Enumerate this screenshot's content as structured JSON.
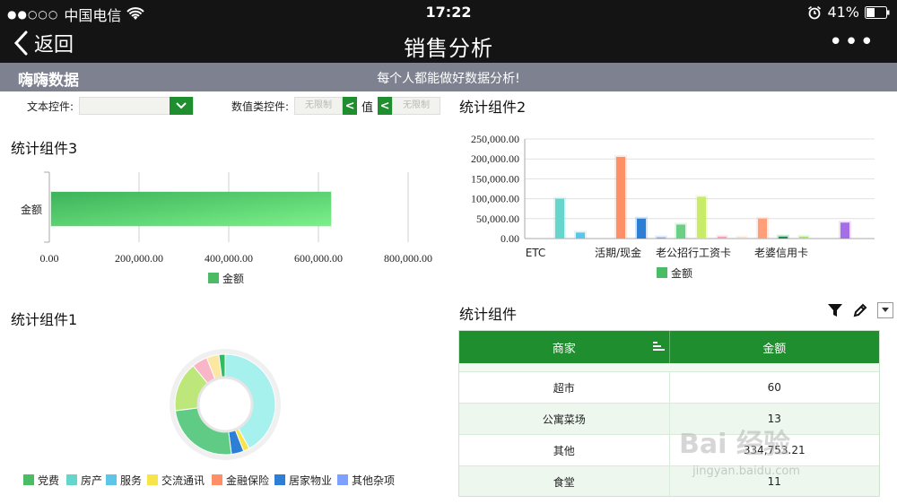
{
  "status_bar": {
    "signal": "●●○○○",
    "carrier": "中国电信",
    "time": "17:22",
    "battery": "41%"
  },
  "nav": {
    "back_label": "返回",
    "title": "销售分析",
    "more_label": "•••"
  },
  "banner": {
    "title": "嗨嗨数据",
    "slogan": "每个人都能做好数据分析!"
  },
  "filters": {
    "text_label": "文本控件:",
    "text_value": "",
    "numeric_label": "数值类控件:",
    "min_placeholder": "无限制",
    "max_placeholder": "无限制",
    "separator": "值",
    "lt_symbol": "<"
  },
  "widgets": {
    "w3_title": "统计组件3",
    "w2_title": "统计组件2",
    "w1_title": "统计组件1",
    "table_title": "统计组件"
  },
  "colors": {
    "accent": "#1f8e2e",
    "banner": "#7e8290",
    "bar_green": "#5bd16a"
  },
  "chart_data": [
    {
      "type": "bar",
      "orientation": "horizontal",
      "categories": [
        "金额"
      ],
      "series": [
        {
          "name": "金额",
          "values": [
            628000
          ]
        }
      ],
      "xlim": [
        0,
        800000
      ],
      "ticks": [
        "0.00",
        "200,000.00",
        "400,000.00",
        "600,000.00",
        "800,000.00"
      ],
      "legend": [
        "金额"
      ],
      "legend_position": "bottom",
      "grid": true
    },
    {
      "type": "bar",
      "categories": [
        "ETC",
        "活期/现金",
        "老公招行工资卡",
        "老婆信用卡"
      ],
      "series": [
        {
          "name": "金额"
        }
      ],
      "bar_values": [
        100000,
        15000,
        205000,
        50000,
        3000,
        35000,
        105000,
        5000,
        3000,
        50000,
        5000,
        5000,
        40000
      ],
      "bar_colors": [
        "#66d6cc",
        "#5bc6e8",
        "#ff8f66",
        "#2d7fd6",
        "#7ea0ff",
        "#6ccf86",
        "#c8ec6a",
        "#f0a3b6",
        "#f7c9a8",
        "#ff9f7a",
        "#1e8c4e",
        "#a5e07a",
        "#a46ee6"
      ],
      "ylim": [
        0,
        250000
      ],
      "ticks": [
        "0.00",
        "50,000.00",
        "100,000.00",
        "150,000.00",
        "200,000.00",
        "250,000.00"
      ],
      "legend": [
        "金额"
      ],
      "legend_position": "bottom",
      "grid": true
    },
    {
      "type": "pie",
      "donut": true,
      "slices": [
        {
          "name": "服务",
          "value": 42,
          "color": "#a6f0ee"
        },
        {
          "name": "交流通讯",
          "value": 2,
          "color": "#f7e34a"
        },
        {
          "name": "居家物业",
          "value": 4,
          "color": "#2d7fd6"
        },
        {
          "name": "党费",
          "value": 25,
          "color": "#5fcb84"
        },
        {
          "name": "房产",
          "value": 16,
          "color": "#bde77a"
        },
        {
          "name": "金融保险",
          "value": 5,
          "color": "#f8b6c6"
        },
        {
          "name": "其他杂项",
          "value": 4,
          "color": "#fbe6a2"
        },
        {
          "name": "党费",
          "value": 2,
          "color": "#2ebd62"
        }
      ],
      "legend": [
        {
          "name": "党费",
          "color": "#4cbb66"
        },
        {
          "name": "房产",
          "color": "#66d6cc"
        },
        {
          "name": "服务",
          "color": "#5bc6e8"
        },
        {
          "name": "交流通讯",
          "color": "#f7e34a"
        },
        {
          "name": "金融保险",
          "color": "#ff8f66"
        },
        {
          "name": "居家物业",
          "color": "#2d7fd6"
        },
        {
          "name": "其他杂项",
          "color": "#7ea0ff"
        }
      ],
      "legend_position": "bottom"
    },
    {
      "type": "table",
      "columns": [
        "商家",
        "金额"
      ],
      "rows": [
        [
          "超市",
          "60"
        ],
        [
          "公寓菜场",
          "13"
        ],
        [
          "其他",
          "334,753.21"
        ],
        [
          "食堂",
          "11"
        ]
      ]
    }
  ],
  "watermark": {
    "text": "Bai 经验",
    "sub": "jingyan.baidu.com"
  }
}
